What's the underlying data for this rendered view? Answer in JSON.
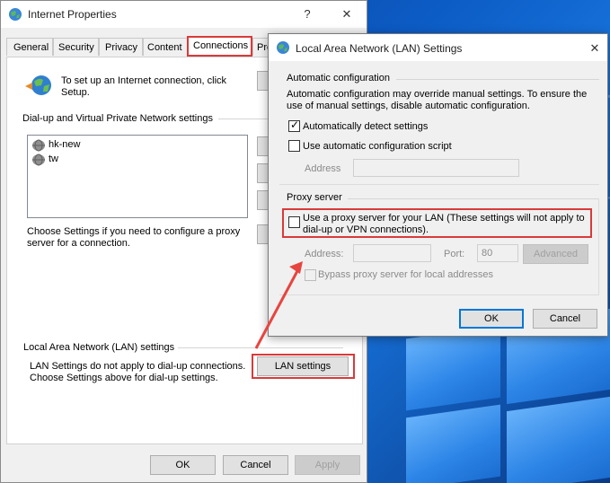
{
  "ip": {
    "title": "Internet Properties",
    "help_glyph": "?",
    "close_glyph": "✕",
    "tabs": [
      {
        "label": "General"
      },
      {
        "label": "Security"
      },
      {
        "label": "Privacy"
      },
      {
        "label": "Content"
      },
      {
        "label": "Connections"
      },
      {
        "label": "Pro"
      }
    ],
    "setup_text_line1": "To set up an Internet connection, click",
    "setup_text_line2": "Setup.",
    "dialup_heading": "Dial-up and Virtual Private Network settings",
    "connections": [
      {
        "name": "hk-new"
      },
      {
        "name": "tw"
      }
    ],
    "proxy_note_line1": "Choose Settings if you need to configure a proxy",
    "proxy_note_line2": "server for a connection.",
    "lan_heading": "Local Area Network (LAN) settings",
    "lan_note_line1": "LAN Settings do not apply to dial-up connections.",
    "lan_note_line2": "Choose Settings above for dial-up settings.",
    "lan_button": "LAN settings",
    "ok": "OK",
    "cancel": "Cancel",
    "apply": "Apply"
  },
  "lan": {
    "title": "Local Area Network (LAN) Settings",
    "close_glyph": "✕",
    "auto_heading": "Automatic configuration",
    "auto_desc_line1": "Automatic configuration may override manual settings.  To ensure the",
    "auto_desc_line2": "use of manual settings, disable automatic configuration.",
    "auto_detect_label": "Automatically detect settings",
    "auto_detect_checked": true,
    "auto_script_label": "Use automatic configuration script",
    "auto_script_checked": false,
    "script_address_label": "Address",
    "proxy_heading": "Proxy server",
    "use_proxy_label_line1": "Use a proxy server for your LAN (These settings will not apply to",
    "use_proxy_label_line2": "dial-up or VPN connections).",
    "use_proxy_checked": false,
    "proxy_address_label": "Address:",
    "proxy_port_label": "Port:",
    "proxy_port_value": "80",
    "advanced_button": "Advanced",
    "bypass_label": "Bypass proxy server for local addresses",
    "ok": "OK",
    "cancel": "Cancel"
  },
  "colors": {
    "highlight": "#d93a3a",
    "arrow": "#e8443f",
    "desktop": "#0c5bc4"
  }
}
